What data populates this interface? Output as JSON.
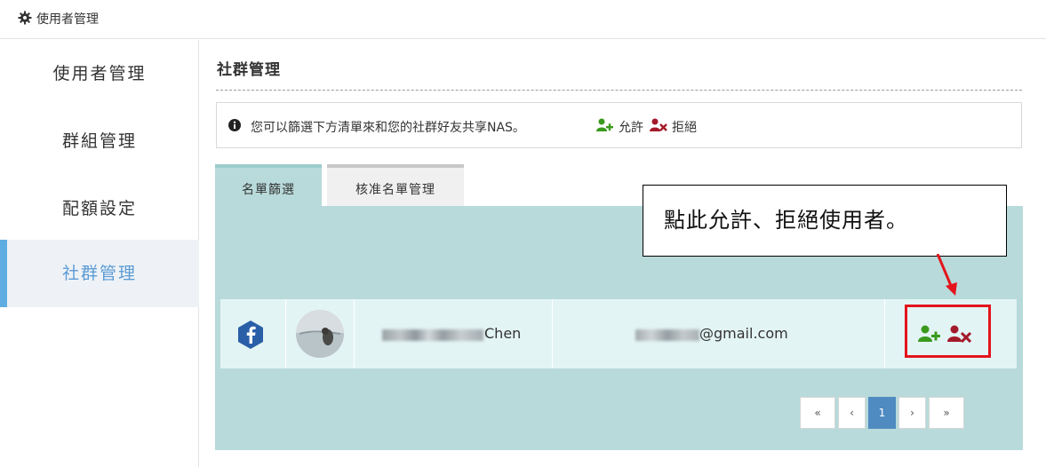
{
  "header": {
    "breadcrumb": "使用者管理",
    "icon": "gear-icon"
  },
  "sidebar": {
    "items": [
      {
        "label": "使用者管理",
        "active": false
      },
      {
        "label": "群組管理",
        "active": false
      },
      {
        "label": "配額設定",
        "active": false
      },
      {
        "label": "社群管理",
        "active": true
      }
    ]
  },
  "main": {
    "title": "社群管理",
    "info": {
      "text": "您可以篩選下方清單來和您的社群好友共享NAS。",
      "allow_label": "允許",
      "deny_label": "拒絕"
    },
    "tabs": [
      {
        "label": "名單篩選",
        "active": true
      },
      {
        "label": "核准名單管理",
        "active": false
      }
    ],
    "rows": [
      {
        "provider_icon": "facebook-icon",
        "avatar": "avatar",
        "name_visible_part": "Chen",
        "email_visible_part": "@gmail.com",
        "actions": [
          "add-user-icon",
          "remove-user-icon"
        ]
      }
    ],
    "pagination": {
      "first": "«",
      "prev": "‹",
      "current": "1",
      "next": "›",
      "last": "»"
    }
  },
  "annotation": {
    "callout_text": "點此允許、拒絕使用者。"
  },
  "colors": {
    "panel": "#b8dada",
    "row": "#e3f4f4",
    "allow_green": "#3a9a1c",
    "deny_red": "#a31a2a",
    "active_blue": "#5dade2",
    "highlight_red": "#e4141c"
  }
}
